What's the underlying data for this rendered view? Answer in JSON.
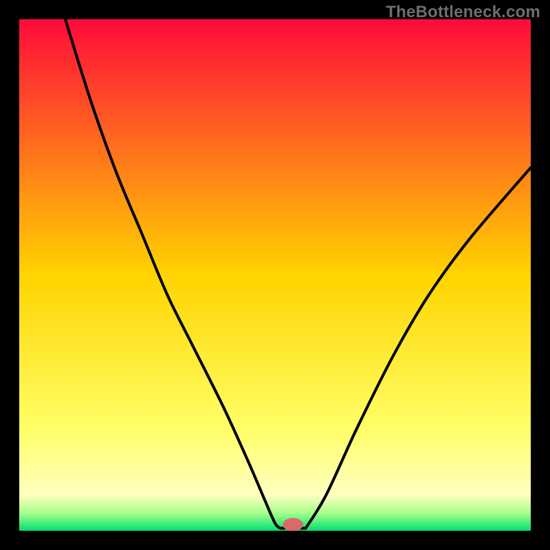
{
  "watermark": "TheBottleneck.com",
  "chart_data": {
    "type": "line",
    "title": "",
    "xlabel": "",
    "ylabel": "",
    "xlim": [
      0,
      100
    ],
    "ylim": [
      0,
      100
    ],
    "gradient": {
      "stops": [
        {
          "offset": 0.0,
          "color": "#ff0a3a"
        },
        {
          "offset": 0.5,
          "color": "#ffd400"
        },
        {
          "offset": 0.8,
          "color": "#ffff66"
        },
        {
          "offset": 0.93,
          "color": "#ffffc0"
        },
        {
          "offset": 0.965,
          "color": "#a8ff8c"
        },
        {
          "offset": 1.0,
          "color": "#00e070"
        }
      ]
    },
    "series": [
      {
        "name": "curve-left",
        "x": [
          9,
          14,
          19,
          24,
          29,
          34,
          40,
          45,
          48,
          50,
          51
        ],
        "y": [
          100,
          84,
          70,
          58,
          46,
          36,
          24,
          13,
          6,
          1.5,
          0.5
        ]
      },
      {
        "name": "valley-floor",
        "x": [
          51,
          56
        ],
        "y": [
          0.5,
          0.5
        ]
      },
      {
        "name": "curve-right",
        "x": [
          56,
          60,
          66,
          73,
          80,
          88,
          100
        ],
        "y": [
          0.5,
          7,
          20,
          34,
          46,
          57,
          71
        ]
      }
    ],
    "marker": {
      "name": "sweet-spot",
      "x": 53.5,
      "y": 1.2,
      "rx": 2.0,
      "ry": 1.3,
      "color": "#d86a6a"
    }
  }
}
